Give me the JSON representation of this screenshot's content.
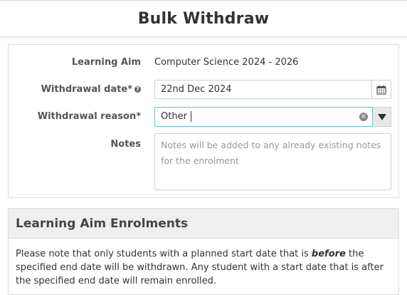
{
  "header": {
    "title": "Bulk Withdraw"
  },
  "form": {
    "learning_aim_label": "Learning Aim",
    "learning_aim_value": "Computer Science 2024 - 2026",
    "withdrawal_date_label": "Withdrawal date*",
    "withdrawal_date_value": "22nd Dec 2024",
    "withdrawal_reason_label": "Withdrawal reason*",
    "withdrawal_reason_value": "Other",
    "notes_label": "Notes",
    "notes_placeholder": "Notes will be added to any already existing notes for the enrolment"
  },
  "enrolments": {
    "title": "Learning Aim Enrolments",
    "note_before": "Please note that only students with a planned start date that is ",
    "note_emphasis": "before",
    "note_after": " the specified end date will be withdrawn. Any student with a start date that is after the specified end date will remain enrolled."
  },
  "colors": {
    "focus_border": "#66c2cf",
    "panel_border": "#dcdcdc",
    "header_bg": "#efefef"
  },
  "icons": {
    "help": "question-circle-icon",
    "calendar": "calendar-icon",
    "clear": "clear-circle-icon",
    "dropdown": "caret-down-icon"
  }
}
